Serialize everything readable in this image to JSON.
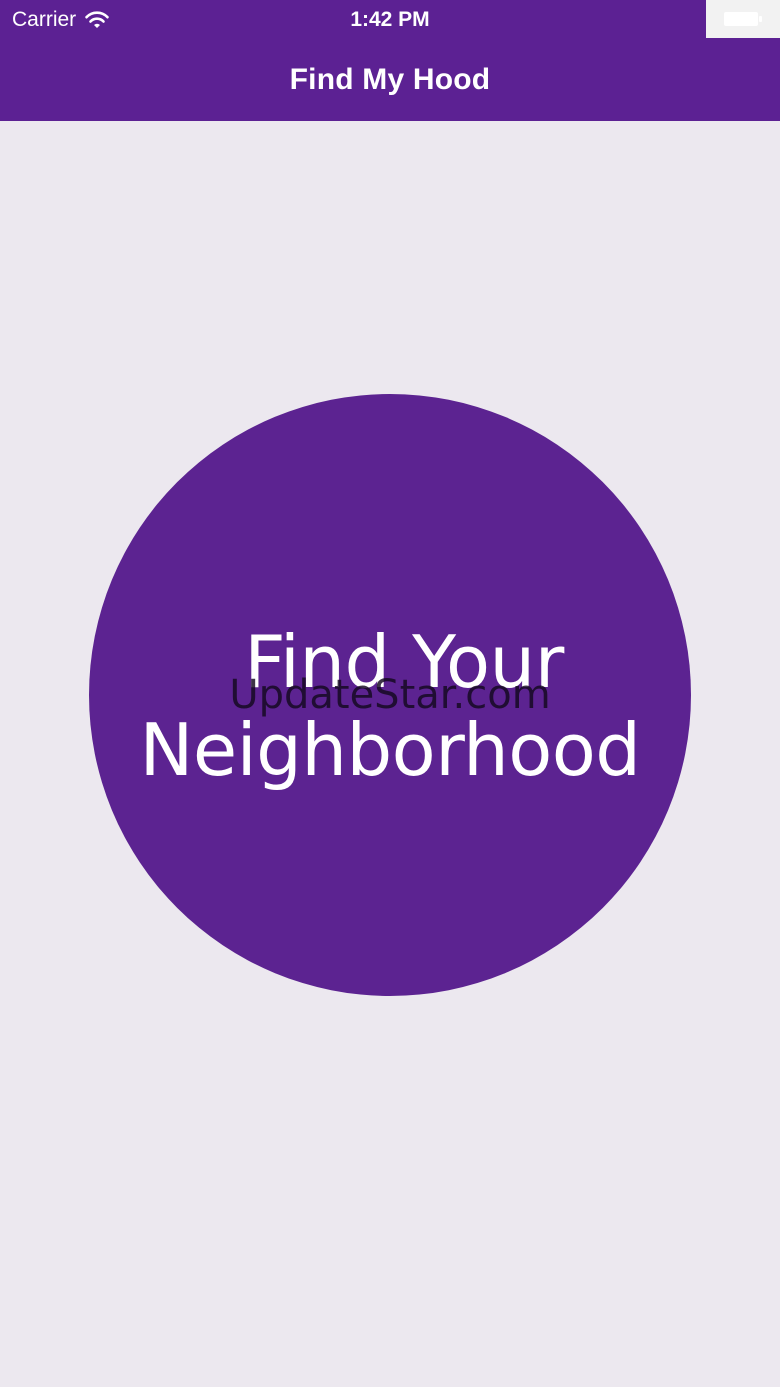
{
  "status_bar": {
    "carrier": "Carrier",
    "time": "1:42 PM"
  },
  "nav": {
    "title": "Find My Hood"
  },
  "main": {
    "button_line1": "Find Your",
    "button_line2": "Neighborhood",
    "watermark": "UpdateStar.com"
  },
  "colors": {
    "brand_purple": "#5c2193",
    "background": "#ece8ef",
    "text_on_brand": "#ffffff"
  },
  "icons": {
    "wifi": "wifi-icon",
    "battery": "battery-icon"
  }
}
